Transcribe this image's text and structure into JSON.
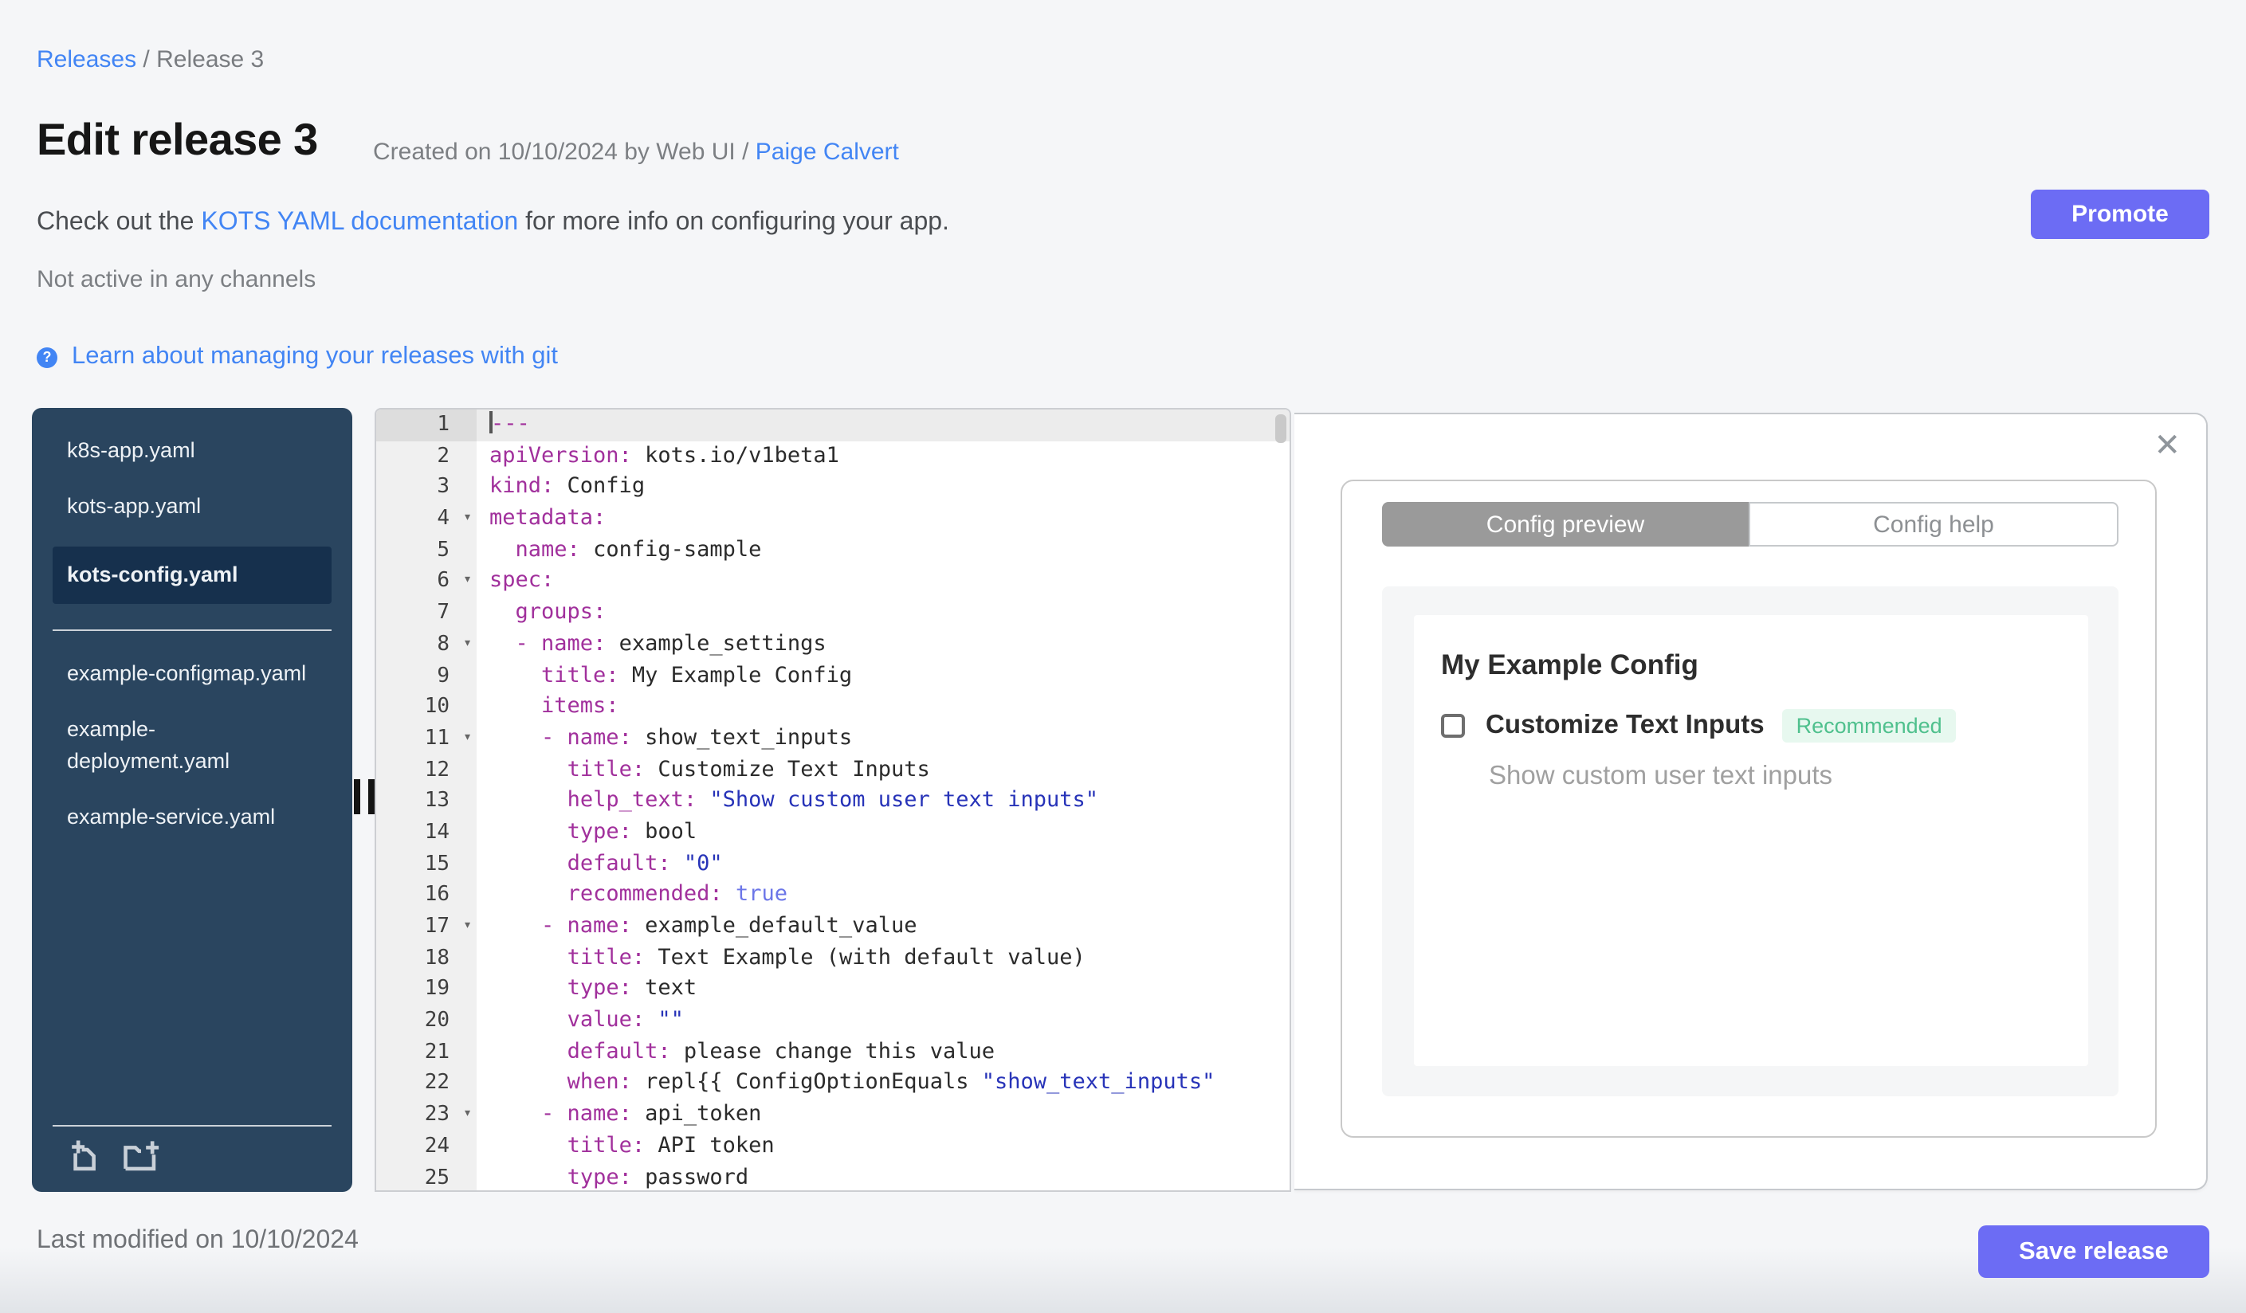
{
  "breadcrumb": {
    "parent": "Releases",
    "separator": " / ",
    "current": "Release 3"
  },
  "header": {
    "title": "Edit release 3",
    "created_text": "Created on 10/10/2024 by Web UI / ",
    "created_author": "Paige Calvert",
    "promote_label": "Promote"
  },
  "notes": {
    "docs_prefix": "Check out the ",
    "docs_link": "KOTS YAML documentation",
    "docs_suffix": " for more info on configuring your app.",
    "channel_status": "Not active in any channels",
    "help_glyph": "?",
    "git_link": "Learn about managing your releases with git"
  },
  "file_tree": {
    "primary_files": [
      {
        "name": "k8s-app.yaml",
        "selected": false
      },
      {
        "name": "kots-app.yaml",
        "selected": false
      },
      {
        "name": "kots-config.yaml",
        "selected": true
      }
    ],
    "secondary_files": [
      {
        "name": "example-configmap.yaml",
        "selected": false
      },
      {
        "name": "example-deployment.yaml",
        "selected": false
      },
      {
        "name": "example-service.yaml",
        "selected": false
      }
    ]
  },
  "editor": {
    "lines": [
      {
        "n": 1,
        "active": true,
        "fold": false,
        "tokens": [
          [
            "doc",
            "---"
          ]
        ]
      },
      {
        "n": 2,
        "active": false,
        "fold": false,
        "tokens": [
          [
            "key",
            "apiVersion:"
          ],
          [
            "plain",
            " kots.io/v1beta1"
          ]
        ]
      },
      {
        "n": 3,
        "active": false,
        "fold": false,
        "tokens": [
          [
            "key",
            "kind:"
          ],
          [
            "plain",
            " Config"
          ]
        ]
      },
      {
        "n": 4,
        "active": false,
        "fold": true,
        "tokens": [
          [
            "key",
            "metadata:"
          ]
        ]
      },
      {
        "n": 5,
        "active": false,
        "fold": false,
        "tokens": [
          [
            "plain",
            "  "
          ],
          [
            "key",
            "name:"
          ],
          [
            "plain",
            " config-sample"
          ]
        ]
      },
      {
        "n": 6,
        "active": false,
        "fold": true,
        "tokens": [
          [
            "key",
            "spec:"
          ]
        ]
      },
      {
        "n": 7,
        "active": false,
        "fold": false,
        "tokens": [
          [
            "plain",
            "  "
          ],
          [
            "key",
            "groups:"
          ]
        ]
      },
      {
        "n": 8,
        "active": false,
        "fold": true,
        "tokens": [
          [
            "plain",
            "  "
          ],
          [
            "key",
            "- name:"
          ],
          [
            "plain",
            " example_settings"
          ]
        ]
      },
      {
        "n": 9,
        "active": false,
        "fold": false,
        "tokens": [
          [
            "plain",
            "    "
          ],
          [
            "key",
            "title:"
          ],
          [
            "plain",
            " My Example Config"
          ]
        ]
      },
      {
        "n": 10,
        "active": false,
        "fold": false,
        "tokens": [
          [
            "plain",
            "    "
          ],
          [
            "key",
            "items:"
          ]
        ]
      },
      {
        "n": 11,
        "active": false,
        "fold": true,
        "tokens": [
          [
            "plain",
            "    "
          ],
          [
            "key",
            "- name:"
          ],
          [
            "plain",
            " show_text_inputs"
          ]
        ]
      },
      {
        "n": 12,
        "active": false,
        "fold": false,
        "tokens": [
          [
            "plain",
            "      "
          ],
          [
            "key",
            "title:"
          ],
          [
            "plain",
            " Customize Text Inputs"
          ]
        ]
      },
      {
        "n": 13,
        "active": false,
        "fold": false,
        "tokens": [
          [
            "plain",
            "      "
          ],
          [
            "key",
            "help_text:"
          ],
          [
            "plain",
            " "
          ],
          [
            "str",
            "\"Show custom user text inputs\""
          ]
        ]
      },
      {
        "n": 14,
        "active": false,
        "fold": false,
        "tokens": [
          [
            "plain",
            "      "
          ],
          [
            "key",
            "type:"
          ],
          [
            "plain",
            " bool"
          ]
        ]
      },
      {
        "n": 15,
        "active": false,
        "fold": false,
        "tokens": [
          [
            "plain",
            "      "
          ],
          [
            "key",
            "default:"
          ],
          [
            "plain",
            " "
          ],
          [
            "str",
            "\"0\""
          ]
        ]
      },
      {
        "n": 16,
        "active": false,
        "fold": false,
        "tokens": [
          [
            "plain",
            "      "
          ],
          [
            "key",
            "recommended:"
          ],
          [
            "plain",
            " "
          ],
          [
            "bool",
            "true"
          ]
        ]
      },
      {
        "n": 17,
        "active": false,
        "fold": true,
        "tokens": [
          [
            "plain",
            "    "
          ],
          [
            "key",
            "- name:"
          ],
          [
            "plain",
            " example_default_value"
          ]
        ]
      },
      {
        "n": 18,
        "active": false,
        "fold": false,
        "tokens": [
          [
            "plain",
            "      "
          ],
          [
            "key",
            "title:"
          ],
          [
            "plain",
            " Text Example (with default value)"
          ]
        ]
      },
      {
        "n": 19,
        "active": false,
        "fold": false,
        "tokens": [
          [
            "plain",
            "      "
          ],
          [
            "key",
            "type:"
          ],
          [
            "plain",
            " text"
          ]
        ]
      },
      {
        "n": 20,
        "active": false,
        "fold": false,
        "tokens": [
          [
            "plain",
            "      "
          ],
          [
            "key",
            "value:"
          ],
          [
            "plain",
            " "
          ],
          [
            "str",
            "\"\""
          ]
        ]
      },
      {
        "n": 21,
        "active": false,
        "fold": false,
        "tokens": [
          [
            "plain",
            "      "
          ],
          [
            "key",
            "default:"
          ],
          [
            "plain",
            " please change this value"
          ]
        ]
      },
      {
        "n": 22,
        "active": false,
        "fold": false,
        "tokens": [
          [
            "plain",
            "      "
          ],
          [
            "key",
            "when:"
          ],
          [
            "plain",
            " repl{{ ConfigOptionEquals "
          ],
          [
            "str",
            "\"show_text_inputs\""
          ]
        ]
      },
      {
        "n": 23,
        "active": false,
        "fold": true,
        "tokens": [
          [
            "plain",
            "    "
          ],
          [
            "key",
            "- name:"
          ],
          [
            "plain",
            " api_token"
          ]
        ]
      },
      {
        "n": 24,
        "active": false,
        "fold": false,
        "tokens": [
          [
            "plain",
            "      "
          ],
          [
            "key",
            "title:"
          ],
          [
            "plain",
            " API token"
          ]
        ]
      },
      {
        "n": 25,
        "active": false,
        "fold": false,
        "tokens": [
          [
            "plain",
            "      "
          ],
          [
            "key",
            "type:"
          ],
          [
            "plain",
            " password"
          ]
        ]
      }
    ]
  },
  "preview": {
    "close_glyph": "✕",
    "tabs": [
      {
        "label": "Config preview",
        "active": true
      },
      {
        "label": "Config help",
        "active": false
      }
    ],
    "group_title": "My Example Config",
    "item": {
      "label": "Customize Text Inputs",
      "badge": "Recommended",
      "help_text": "Show custom user text inputs",
      "checked": false
    }
  },
  "footer": {
    "last_modified": "Last modified on 10/10/2024",
    "save_label": "Save release"
  },
  "colors": {
    "accent": "#6c6cf4",
    "link": "#4285f4",
    "sidebar_bg": "#2a455f",
    "sidebar_selected_bg": "#16304d",
    "badge_bg": "#e7f8ef",
    "badge_text": "#4fc08d",
    "yaml_key": "#a1309c",
    "yaml_string": "#2733b8"
  }
}
